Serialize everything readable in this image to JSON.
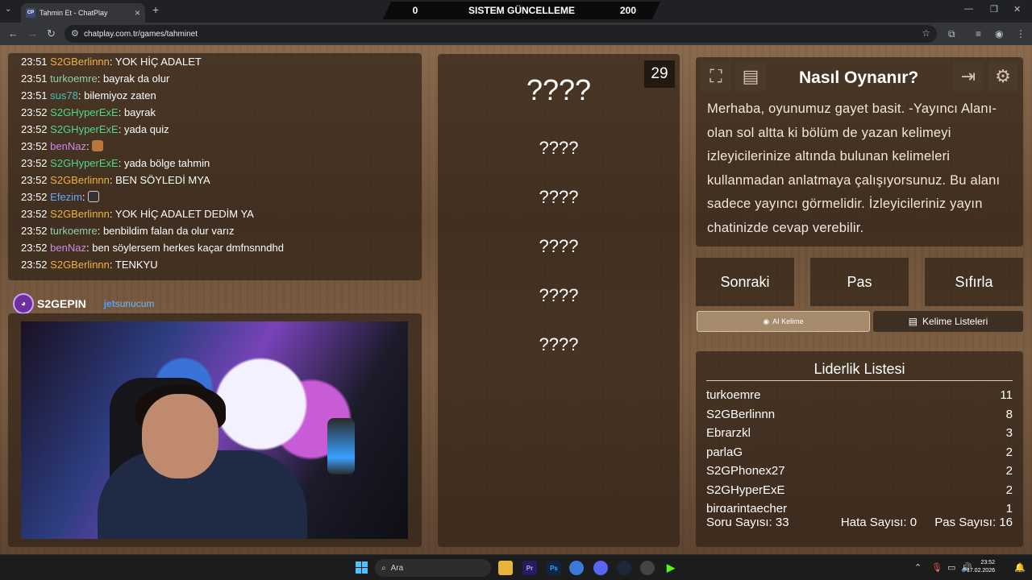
{
  "browser": {
    "tab_title": "Tahmin Et - ChatPlay",
    "tab_favicon": "CP",
    "url": "chatplay.com.tr/games/tahminet"
  },
  "system_banner": {
    "left": "0",
    "center": "SISTEM GÜNCELLEME",
    "right": "200"
  },
  "chat": [
    {
      "time": "23:51",
      "nick": "S2GBerlinnn",
      "color": "#f0b143",
      "text": "YOK HİÇ ADALET"
    },
    {
      "time": "23:51",
      "nick": "turkoemre",
      "color": "#8ed0b0",
      "text": "bayrak da olur"
    },
    {
      "time": "23:51",
      "nick": "sus78",
      "color": "#44c0b0",
      "text": "bilemiyoz zaten"
    },
    {
      "time": "23:52",
      "nick": "S2GHyperExE",
      "color": "#4ed88a",
      "text": "bayrak"
    },
    {
      "time": "23:52",
      "nick": "S2GHyperExE",
      "color": "#4ed88a",
      "text": "yada quiz"
    },
    {
      "time": "23:52",
      "nick": "benNaz",
      "color": "#d08ae6",
      "text": "",
      "emote": "monkey"
    },
    {
      "time": "23:52",
      "nick": "S2GHyperExE",
      "color": "#4ed88a",
      "text": "yada bölge tahmin"
    },
    {
      "time": "23:52",
      "nick": "S2GBerlinnn",
      "color": "#f0b143",
      "text": "BEN SÖYLEDİ MYA"
    },
    {
      "time": "23:52",
      "nick": "Efezim",
      "color": "#6aa6ff",
      "text": "",
      "emote": "face"
    },
    {
      "time": "23:52",
      "nick": "S2GBerlinnn",
      "color": "#f0b143",
      "text": "YOK HİÇ ADALET DEDİM YA"
    },
    {
      "time": "23:52",
      "nick": "turkoemre",
      "color": "#8ed0b0",
      "text": "benbildim falan da olur varız"
    },
    {
      "time": "23:52",
      "nick": "benNaz",
      "color": "#d08ae6",
      "text": "ben söylersem herkes kaçar dmfnsnndhd"
    },
    {
      "time": "23:52",
      "nick": "S2GBerlinnn",
      "color": "#f0b143",
      "text": "TENKYU"
    }
  ],
  "sponsors": {
    "s2": "S2GEPIN",
    "jet": "jet",
    "jet_sub": "sunucum"
  },
  "game": {
    "timer": "29",
    "main_word": "????",
    "words": [
      "????",
      "????",
      "????",
      "????",
      "????"
    ]
  },
  "howto": {
    "title": "Nasıl Oynanır?",
    "text": "Merhaba, oyunumuz gayet basit. -Yayıncı Alanı- olan sol altta ki bölüm de yazan kelimeyi izleyicilerinize altında bulunan kelimeleri kullanmadan anlatmaya çalışıyorsunuz. Bu alanı sadece yayıncı görmelidir. İzleyicileriniz yayın chatinizde cevap verebilir."
  },
  "controls": {
    "next": "Sonraki",
    "pass": "Pas",
    "reset": "Sıfırla",
    "ai": "AI Kelime",
    "lists": "Kelime Listeleri"
  },
  "leaderboard": {
    "title": "Liderlik Listesi",
    "rows": [
      {
        "name": "turkoemre",
        "score": "11"
      },
      {
        "name": "S2GBerlinnn",
        "score": "8"
      },
      {
        "name": "Ebrarzkl",
        "score": "3"
      },
      {
        "name": "parlaG",
        "score": "2"
      },
      {
        "name": "S2GPhonex27",
        "score": "2"
      },
      {
        "name": "S2GHyperExE",
        "score": "2"
      },
      {
        "name": "birgarintaecher",
        "score": "1"
      }
    ],
    "questions": "Soru Sayısı: 33",
    "errors": "Hata Sayısı: 0",
    "passes": "Pas Sayısı: 16"
  },
  "taskbar": {
    "search_placeholder": "Ara",
    "time": "23:52",
    "date": "17.02.2026"
  }
}
